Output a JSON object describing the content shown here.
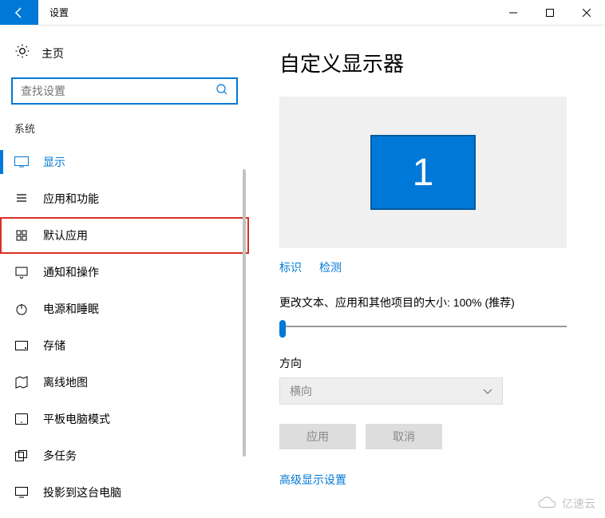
{
  "window": {
    "title": "设置"
  },
  "sidebar": {
    "home_label": "主页",
    "search_placeholder": "查找设置",
    "section_label": "系统",
    "items": [
      {
        "label": "显示",
        "icon": "display-icon",
        "selected": true,
        "highlighted": false
      },
      {
        "label": "应用和功能",
        "icon": "apps-icon",
        "selected": false,
        "highlighted": false
      },
      {
        "label": "默认应用",
        "icon": "default-apps-icon",
        "selected": false,
        "highlighted": true
      },
      {
        "label": "通知和操作",
        "icon": "notifications-icon",
        "selected": false,
        "highlighted": false
      },
      {
        "label": "电源和睡眠",
        "icon": "power-icon",
        "selected": false,
        "highlighted": false
      },
      {
        "label": "存储",
        "icon": "storage-icon",
        "selected": false,
        "highlighted": false
      },
      {
        "label": "离线地图",
        "icon": "maps-icon",
        "selected": false,
        "highlighted": false
      },
      {
        "label": "平板电脑模式",
        "icon": "tablet-icon",
        "selected": false,
        "highlighted": false
      },
      {
        "label": "多任务",
        "icon": "multitask-icon",
        "selected": false,
        "highlighted": false
      },
      {
        "label": "投影到这台电脑",
        "icon": "project-icon",
        "selected": false,
        "highlighted": false
      }
    ]
  },
  "main": {
    "heading": "自定义显示器",
    "monitor_number": "1",
    "identify_link": "标识",
    "detect_link": "检测",
    "scale_label": "更改文本、应用和其他项目的大小: 100% (推荐)",
    "orientation_label": "方向",
    "orientation_value": "横向",
    "apply_btn": "应用",
    "cancel_btn": "取消",
    "advanced_link": "高级显示设置"
  },
  "watermark": "亿速云"
}
